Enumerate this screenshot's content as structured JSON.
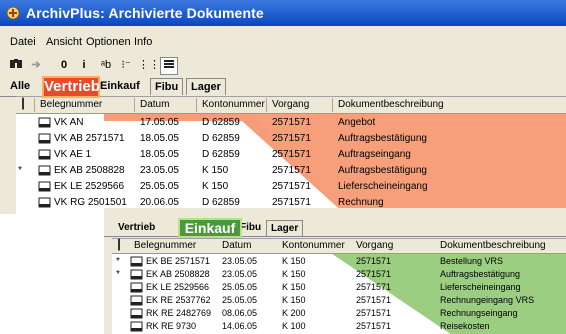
{
  "window": {
    "title": "ArchivPlus: Archivierte Dokumente"
  },
  "menu": [
    "Datei",
    "Ansicht",
    "Optionen",
    "Info"
  ],
  "toolbar": {
    "btn3": "0",
    "btn4": "i",
    "btn5": "ᵃb",
    "btn6": "⁝⁻",
    "btn7": "⋮⋮"
  },
  "tabs_top": [
    "Alle",
    "Einkauf",
    "Fibu",
    "Lager"
  ],
  "callouts": {
    "vertrieb": "Vertrieb",
    "einkauf": "Einkauf"
  },
  "columns": [
    "Belegnummer",
    "Datum",
    "Kontonummer",
    "Vorgang",
    "Dokumentbeschreibung"
  ],
  "rows_top": [
    {
      "mark": "",
      "beleg": "VK AN",
      "datum": "17.05.05",
      "konto": "D 62859",
      "vorgang": "2571571",
      "desc": "Angebot"
    },
    {
      "mark": "",
      "beleg": "VK AB 2571571",
      "datum": "18.05.05",
      "konto": "D 62859",
      "vorgang": "2571571",
      "desc": "Auftragsbestätigung"
    },
    {
      "mark": "",
      "beleg": "VK AE 1",
      "datum": "18.05.05",
      "konto": "D 62859",
      "vorgang": "2571571",
      "desc": "Auftragseingang"
    },
    {
      "mark": "*",
      "beleg": "EK AB 2508828",
      "datum": "23.05.05",
      "konto": "K 150",
      "vorgang": "2571571",
      "desc": "Auftragsbestätigung"
    },
    {
      "mark": "",
      "beleg": "EK LE 2529566",
      "datum": "25.05.05",
      "konto": "K 150",
      "vorgang": "2571571",
      "desc": "Lieferscheineingang"
    },
    {
      "mark": "",
      "beleg": "VK RG 2501501",
      "datum": "20.06.05",
      "konto": "D 62859",
      "vorgang": "2571571",
      "desc": "Rechnung"
    }
  ],
  "tabs_bottom": [
    "Vertrieb",
    "Fibu",
    "Lager"
  ],
  "rows_bottom": [
    {
      "mark": "*",
      "beleg": "EK BE 2571571",
      "datum": "23.05.05",
      "konto": "K 150",
      "vorgang": "2571571",
      "desc": "Bestellung VRS"
    },
    {
      "mark": "*",
      "beleg": "EK AB 2508828",
      "datum": "23.05.05",
      "konto": "K 150",
      "vorgang": "2571571",
      "desc": "Auftragsbestätigung"
    },
    {
      "mark": "",
      "beleg": "EK LE 2529566",
      "datum": "25.05.05",
      "konto": "K 150",
      "vorgang": "2571571",
      "desc": "Lieferscheineingang"
    },
    {
      "mark": "",
      "beleg": "EK RE 2537762",
      "datum": "25.05.05",
      "konto": "K 150",
      "vorgang": "2571571",
      "desc": "Rechnungeingang VRS"
    },
    {
      "mark": "",
      "beleg": "RK RE 2482769",
      "datum": "08.06.05",
      "konto": "K 200",
      "vorgang": "2571571",
      "desc": "Rechnungseingang"
    },
    {
      "mark": "",
      "beleg": "RK RE 9730",
      "datum": "14.06.05",
      "konto": "K 100",
      "vorgang": "2571571",
      "desc": "Reisekosten"
    }
  ],
  "colors": {
    "vertrieb_highlight": "#f07a50",
    "einkauf_highlight": "#8cc46a"
  }
}
